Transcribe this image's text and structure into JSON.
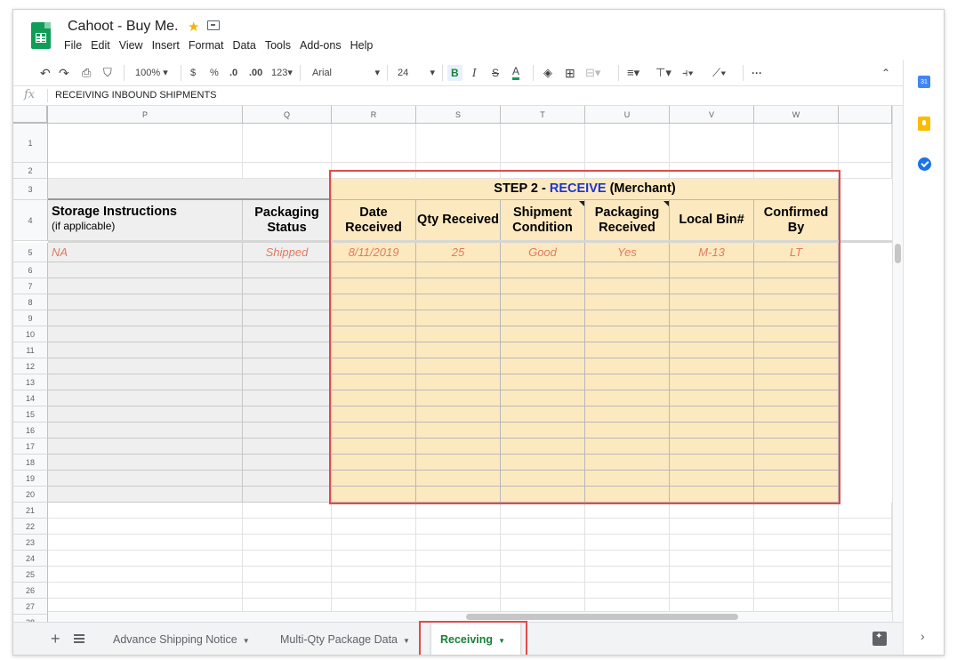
{
  "app": {
    "title": "Cahoot - Buy Me.",
    "menu": [
      "File",
      "Edit",
      "View",
      "Insert",
      "Format",
      "Data",
      "Tools",
      "Add-ons",
      "Help"
    ]
  },
  "toolbar": {
    "zoom": "100%",
    "currency": "$",
    "percent": "%",
    "dec_less": ".0",
    "dec_more": ".00",
    "more_formats": "123",
    "font": "Arial",
    "font_size": "24",
    "bold": "B",
    "italic": "I",
    "strike": "S",
    "text_color": "A",
    "more": "···"
  },
  "formula": {
    "label": "fx",
    "content": "RECEIVING INBOUND SHIPMENTS"
  },
  "columns": [
    "P",
    "Q",
    "R",
    "S",
    "T",
    "U",
    "V",
    "W"
  ],
  "rows": [
    "1",
    "2",
    "3",
    "4",
    "5",
    "6",
    "7",
    "8",
    "9",
    "10",
    "11",
    "12",
    "13",
    "14",
    "15",
    "16",
    "17",
    "18",
    "19",
    "20",
    "21",
    "22",
    "23",
    "24",
    "25",
    "26",
    "27",
    "28"
  ],
  "step": {
    "prefix": "STEP 2 - ",
    "accent": "RECEIVE",
    "suffix": " (Merchant)"
  },
  "headers": {
    "storage_title": "Storage Instructions",
    "storage_sub": "(if applicable)",
    "packaging_status": "Packaging Status",
    "date_received": "Date Received",
    "qty_received": "Qty Received",
    "shipment_condition": "Shipment Condition",
    "packaging_received": "Packaging Received",
    "local_bin": "Local Bin#",
    "confirmed_by": "Confirmed By"
  },
  "row5": {
    "storage": "NA",
    "packaging_status": "Shipped",
    "date_received": "8/11/2019",
    "qty_received": "25",
    "shipment_condition": "Good",
    "packaging_received": "Yes",
    "local_bin": "M-13",
    "confirmed_by": "LT"
  },
  "side": {
    "calendar_day": "31"
  },
  "tabs": [
    {
      "label": "Advance Shipping Notice"
    },
    {
      "label": "Multi-Qty Package Data"
    },
    {
      "label": "Receiving"
    }
  ],
  "colors": {
    "accent_green": "#188038",
    "header_yellow": "#fde9c0",
    "value_orange": "#e07a5f",
    "step_blue": "#1a35d6",
    "highlight_red": "#e04b4b"
  }
}
